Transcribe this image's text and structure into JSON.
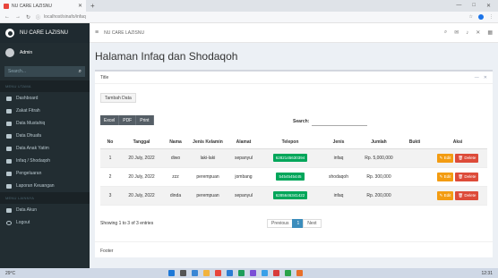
{
  "browser": {
    "tab_title": "NU CARE LAZISNU",
    "new_tab": "+",
    "url": "localhost/sinafo/infaq",
    "window_controls": [
      "—",
      "□",
      "✕"
    ]
  },
  "sidebar": {
    "brand": "NU CARE LAZISNU",
    "user": "Admin",
    "search_placeholder": "Search...",
    "sections": [
      {
        "header": "MENU UTAMA",
        "items": [
          {
            "label": "Dashboard",
            "icon": "dashboard-icon"
          },
          {
            "label": "Zakat Fitrah",
            "icon": "table-icon"
          },
          {
            "label": "Data Mustahiq",
            "icon": "table-icon"
          },
          {
            "label": "Data Dhuafa",
            "icon": "table-icon"
          },
          {
            "label": "Data Anak Yatim",
            "icon": "table-icon"
          },
          {
            "label": "Infaq / Shodaqoh",
            "icon": "table-icon"
          },
          {
            "label": "Pengeluaran",
            "icon": "table-icon"
          },
          {
            "label": "Laporan Keuangan",
            "icon": "table-icon"
          }
        ]
      },
      {
        "header": "MENU LAINNYA",
        "items": [
          {
            "label": "Data Akun",
            "icon": "users-icon"
          },
          {
            "label": "Logout",
            "icon": "logout-icon"
          }
        ]
      }
    ]
  },
  "topnav": {
    "title": "NU CARE LAZISNU"
  },
  "main": {
    "page_title": "Halaman Infaq dan Shodaqoh",
    "box_title": "Title",
    "add_button": "Tambah Data",
    "export_buttons": [
      "Excel",
      "PDF",
      "Print"
    ],
    "search_label": "Search:",
    "columns": [
      "No",
      "Tanggal",
      "Nama",
      "Jenis Kelamin",
      "Alamat",
      "Telepon",
      "Jenis",
      "Jumlah",
      "Bukti",
      "Aksi"
    ],
    "rows": [
      [
        "1",
        "20 July, 2022",
        "diwo",
        "laki-laki",
        "sepanyul",
        "6282145630394",
        "infaq",
        "Rp. 5,000,000",
        "",
        ""
      ],
      [
        "2",
        "20 July, 2022",
        "zzz",
        "perempuan",
        "jombang",
        "5454545445",
        "shodaqoh",
        "Rp. 300,000",
        "",
        ""
      ],
      [
        "3",
        "20 July, 2022",
        "dinda",
        "perempuan",
        "sepanyul",
        "6285646341422",
        "infaq",
        "Rp. 200,000",
        "",
        ""
      ]
    ],
    "edit_label": "Edit",
    "delete_label": "Delete",
    "info": "Showing 1 to 3 of 3 entries",
    "pager": {
      "prev": "Previous",
      "page": "1",
      "next": "Next"
    },
    "footer": "Footer"
  },
  "taskbar": {
    "weather": "29°C",
    "time": "12:31"
  },
  "colors": {
    "sidebar": "#222d32",
    "primary": "#3c8dbc",
    "success": "#00a65a",
    "warning": "#f39c12",
    "danger": "#dd4b39"
  }
}
